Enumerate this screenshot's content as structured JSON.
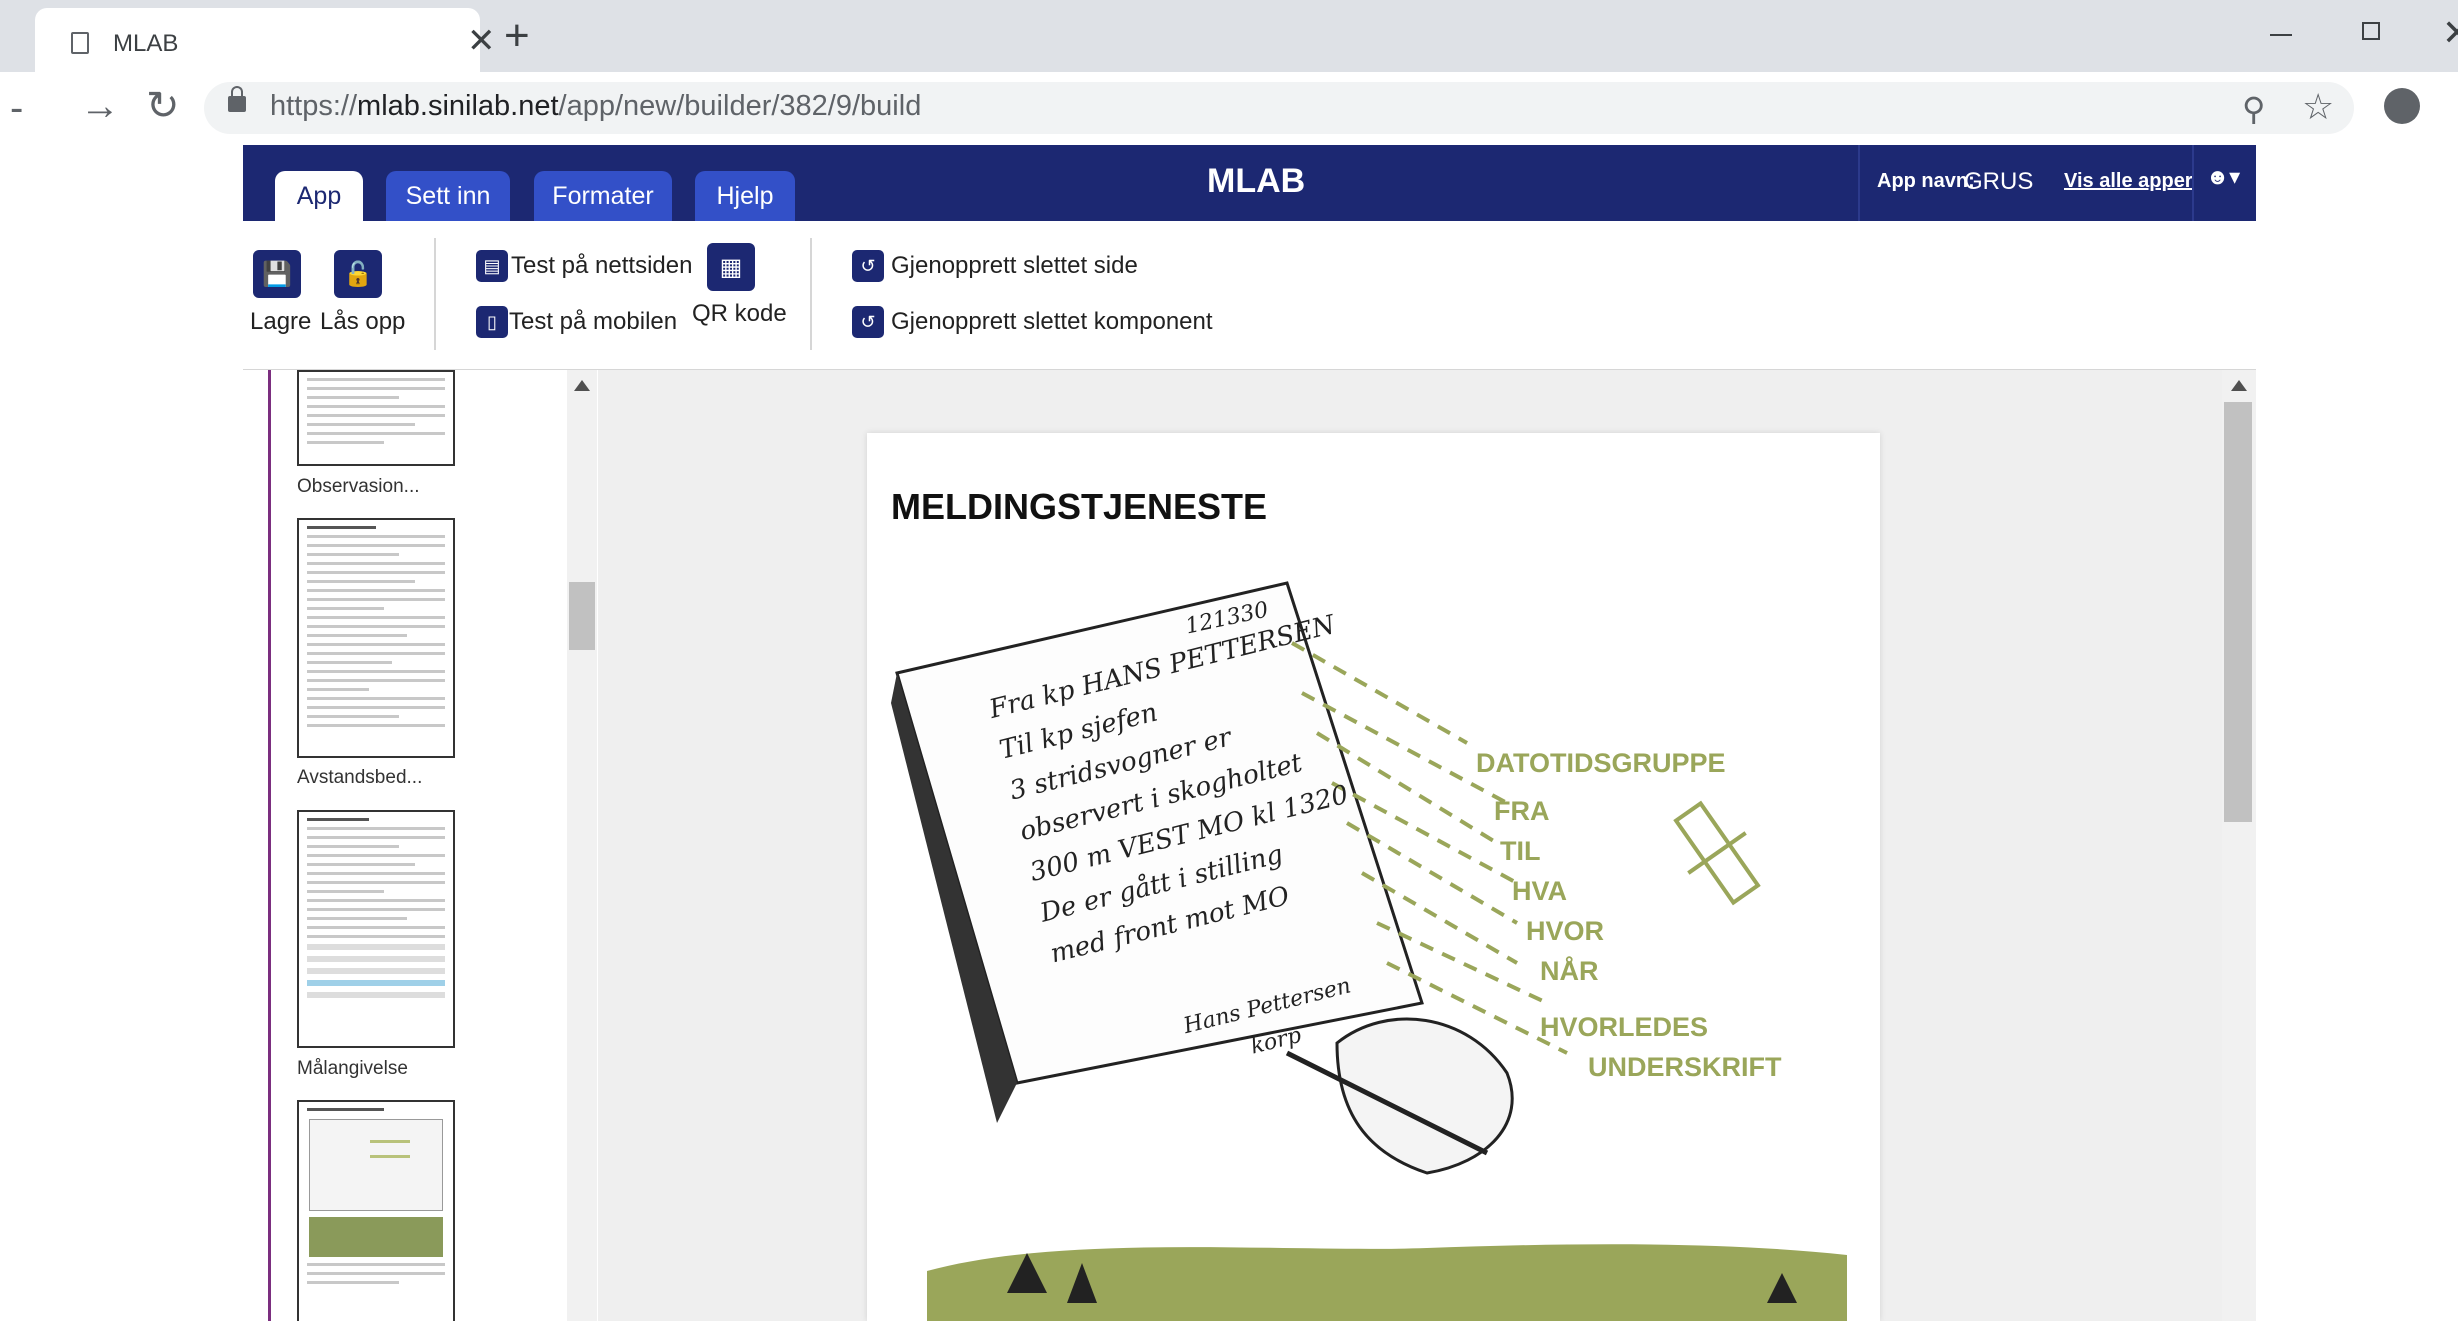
{
  "browser": {
    "tab_title": "MLAB",
    "url_prefix": "https://",
    "url_host": "mlab.sinilab.net",
    "url_path": "/app/new/builder/382/9/build",
    "new_tab_symbol": "+",
    "close_symbol": "✕"
  },
  "header": {
    "tabs": [
      {
        "label": "App"
      },
      {
        "label": "Sett inn"
      },
      {
        "label": "Formater"
      },
      {
        "label": "Hjelp"
      }
    ],
    "title": "MLAB",
    "app_name_label": "App navn:",
    "app_name_value": "GRUS",
    "vis_alle": "Vis alle apper",
    "user_icon": "▾"
  },
  "ribbon": {
    "save": "Lagre",
    "unlock": "Lås opp",
    "test_web": "Test på nettsiden",
    "test_mobile": "Test på mobilen",
    "qr": "QR kode",
    "restore_page": "Gjenopprett slettet side",
    "restore_component": "Gjenopprett slettet komponent"
  },
  "pages_panel": {
    "captions": [
      "Observasion...",
      "Avstandsbed...",
      "Målangivelse"
    ]
  },
  "content": {
    "page_title": "MELDINGSTJENESTE",
    "illustration": {
      "note_number": "121330",
      "handwriting": [
        "Fra kp HANS PETTERSEN",
        "Til kp sjefen",
        "3 stridsvogner er",
        "observert i skogholtet",
        "300 m VEST MO kl 1320",
        "De er gått i stilling",
        "med front mot MO",
        "Hans Pettersen",
        "korp"
      ],
      "labels": [
        "DATOTIDSGRUPPE",
        "FRA",
        "TIL",
        "HVA",
        "HVOR",
        "NÅR",
        "HVORLEDES",
        "UNDERSKRIFT"
      ],
      "label_color": "#9aa65a"
    }
  },
  "colors": {
    "header_bg": "#1c2872",
    "tab_bg": "#3350c8",
    "accent_purple": "#7b2e7f"
  }
}
